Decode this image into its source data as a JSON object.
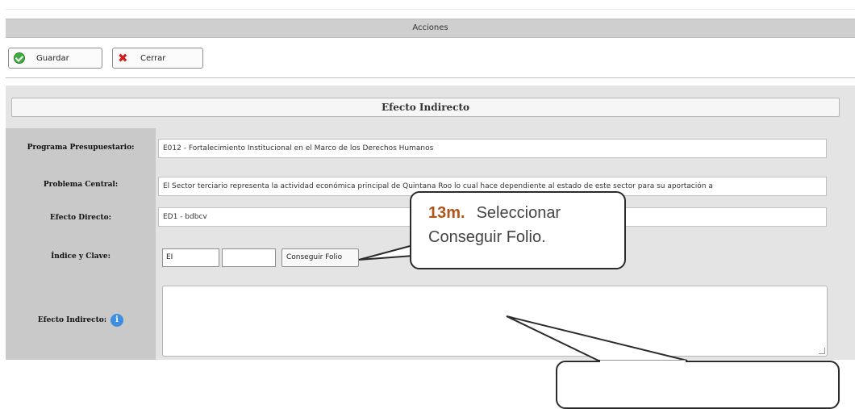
{
  "actions": {
    "title": "Acciones",
    "save_label": "Guardar",
    "close_label": "Cerrar"
  },
  "form": {
    "section_title": "Efecto Indirecto",
    "programa": {
      "label": "Programa Presupuestario:",
      "value": "E012 - Fortalecimiento Institucional en el Marco de los Derechos Humanos"
    },
    "problema": {
      "label": "Problema Central:",
      "value": "El Sector terciario representa la actividad económica principal de Quintana Roo lo cual hace dependiente al estado de este sector para su aportación a"
    },
    "efecto_directo": {
      "label": "Efecto Directo:",
      "value": "ED1 - bdbcv"
    },
    "indice": {
      "label": "Índice y Clave:",
      "index_value": "EI",
      "clave_value": "",
      "folio_button": "Conseguir Folio"
    },
    "efecto_indirecto": {
      "label": "Efecto Indirecto:",
      "value": ""
    }
  },
  "callout": {
    "step": "13m.",
    "text_line1": "Seleccionar",
    "text_line2": "Conseguir Folio."
  },
  "icons": {
    "save": "check-circle-icon",
    "close": "red-x-icon",
    "info": "info-icon"
  }
}
